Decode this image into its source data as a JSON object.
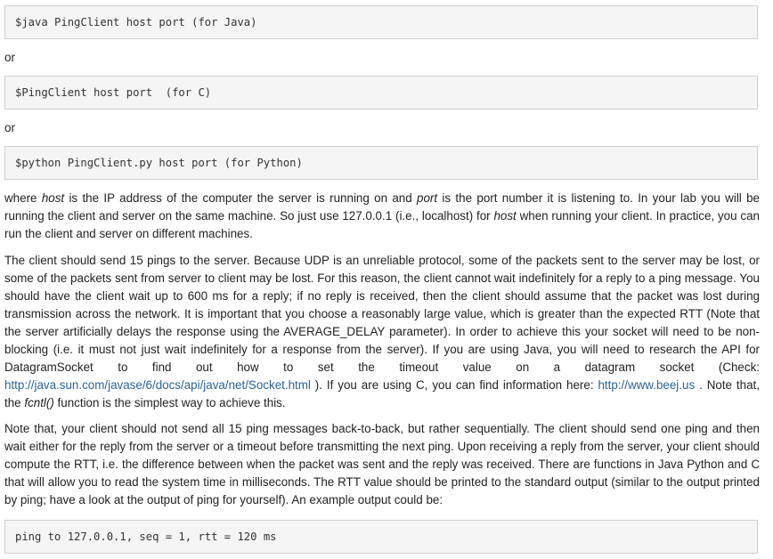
{
  "code_java": "$java PingClient host port (for Java)",
  "or1": "or",
  "code_c": "$PingClient host port  (for C)",
  "or2": "or",
  "code_python": "$python PingClient.py host port (for Python)",
  "p1": {
    "t1": "where ",
    "host1": "host",
    "t2": " is the IP address of the computer the server is running on and ",
    "port": "port",
    "t3": " is the port number it is listening to. In your lab you will be running the client and server on the same machine. So just use 127.0.0.1 (i.e., localhost) for ",
    "host2": "host",
    "t4": " when running your client. In practice, you can run the client and server on different machines."
  },
  "p2": {
    "t1": "The client should send 15 pings to the server. Because UDP is an unreliable protocol, some of the packets sent to the server may be lost, or some of the packets sent from server to client may be lost. For this reason, the client cannot wait indefinitely for a reply to a ping message. You should have the client wait up to 600 ms for a reply; if no reply is received, then the client should assume that the packet was lost during transmission across the network. It is important that you choose a reasonably large value, which is greater than the expected RTT (Note that the server artificially delays the response using the AVERAGE_DELAY parameter). In order to achieve this your socket will need to be non-blocking (i.e. it must not just wait indefinitely for a response from the server). If you are using Java, you will need to research the API for DatagramSocket to find out how to set the timeout value on a datagram socket (Check: ",
    "link1": "http://java.sun.com/javase/6/docs/api/java/net/Socket.html",
    "t2": " ). If you are using C, you can find information here: ",
    "link2": "http://www.beej.us",
    "t3": " . Note that, the ",
    "fn": "fcntl()",
    "t4": " function is the simplest way to achieve this."
  },
  "p3": "Note that, your client should not send all 15 ping messages back-to-back, but rather sequentially. The client should send one ping and then wait either for the reply from the server or a timeout before transmitting the next ping. Upon receiving a reply from the server, your client should compute the RTT, i.e. the difference between when the packet was sent and the reply was received. There are functions in Java Python and C that will allow you to read the system time in milliseconds. The RTT value should be printed to the standard output (similar to the output printed by ping; have a look at the output of ping for yourself). An example output could be:",
  "code_output": "ping to 127.0.0.1, seq = 1, rtt = 120 ms"
}
